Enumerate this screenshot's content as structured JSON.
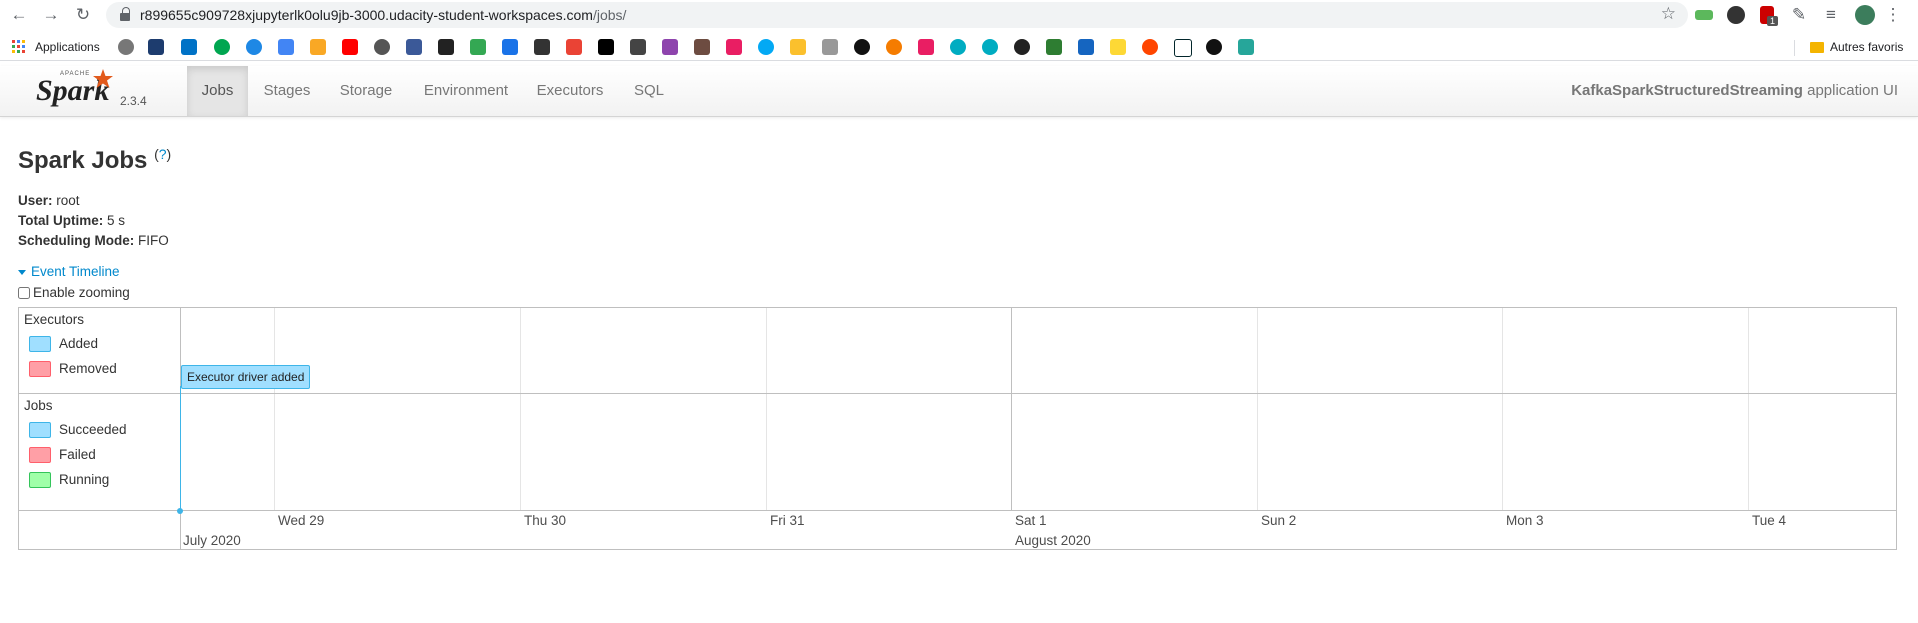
{
  "browser": {
    "url_host": "r899655c909728xjupyterlk0olu9jb-3000.udacity-student-workspaces.com",
    "url_path": "/jobs/",
    "bookmarks_apps_label": "Applications",
    "other_bookmarks_label": "Autres favoris",
    "extension_badge": "1"
  },
  "navbar": {
    "brand_apache": "APACHE",
    "brand_spark": "Spark",
    "version": "2.3.4",
    "tabs": [
      "Jobs",
      "Stages",
      "Storage",
      "Environment",
      "Executors",
      "SQL"
    ],
    "app_name": "KafkaSparkStructuredStreaming",
    "app_suffix": "application UI"
  },
  "page": {
    "title": "Spark Jobs",
    "help": "?",
    "user_label": "User:",
    "user_value": "root",
    "uptime_label": "Total Uptime:",
    "uptime_value": "5 s",
    "scheduling_label": "Scheduling Mode:",
    "scheduling_value": "FIFO",
    "event_timeline_label": "Event Timeline",
    "enable_zooming_label": "Enable zooming"
  },
  "timeline": {
    "executors_group": "Executors",
    "executor_legend": [
      "Added",
      "Removed"
    ],
    "jobs_group": "Jobs",
    "jobs_legend": [
      "Succeeded",
      "Failed",
      "Running"
    ],
    "event_label": "Executor driver added",
    "days": [
      "Wed 29",
      "Thu 30",
      "Fri 31",
      "Sat 1",
      "Sun 2",
      "Mon 3",
      "Tue 4"
    ],
    "months": [
      "July 2020",
      "August 2020"
    ],
    "colors": {
      "added": "#a0dfff",
      "removed": "#ff9fa6",
      "running": "#a0ffa9",
      "link": "#0088cc"
    }
  }
}
